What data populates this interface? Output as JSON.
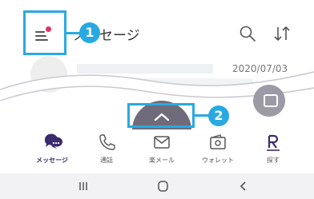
{
  "header": {
    "title": "セージ",
    "title_prefix": "メッ"
  },
  "list": {
    "first_row_date": "2020/07/03"
  },
  "callouts": {
    "one": "1",
    "two": "2"
  },
  "tabs": [
    {
      "label": "メッセージ",
      "icon": "message-bubble-icon",
      "active": true
    },
    {
      "label": "通話",
      "icon": "phone-icon",
      "active": false
    },
    {
      "label": "楽メール",
      "icon": "mail-icon",
      "active": false
    },
    {
      "label": "ウォレット",
      "icon": "wallet-icon",
      "active": false
    },
    {
      "label": "探す",
      "icon": "rakuten-search-icon",
      "active": false
    }
  ],
  "colors": {
    "callout": "#29a9e1",
    "brand": "#3d2a6e",
    "notification_dot": "#e0316d"
  }
}
